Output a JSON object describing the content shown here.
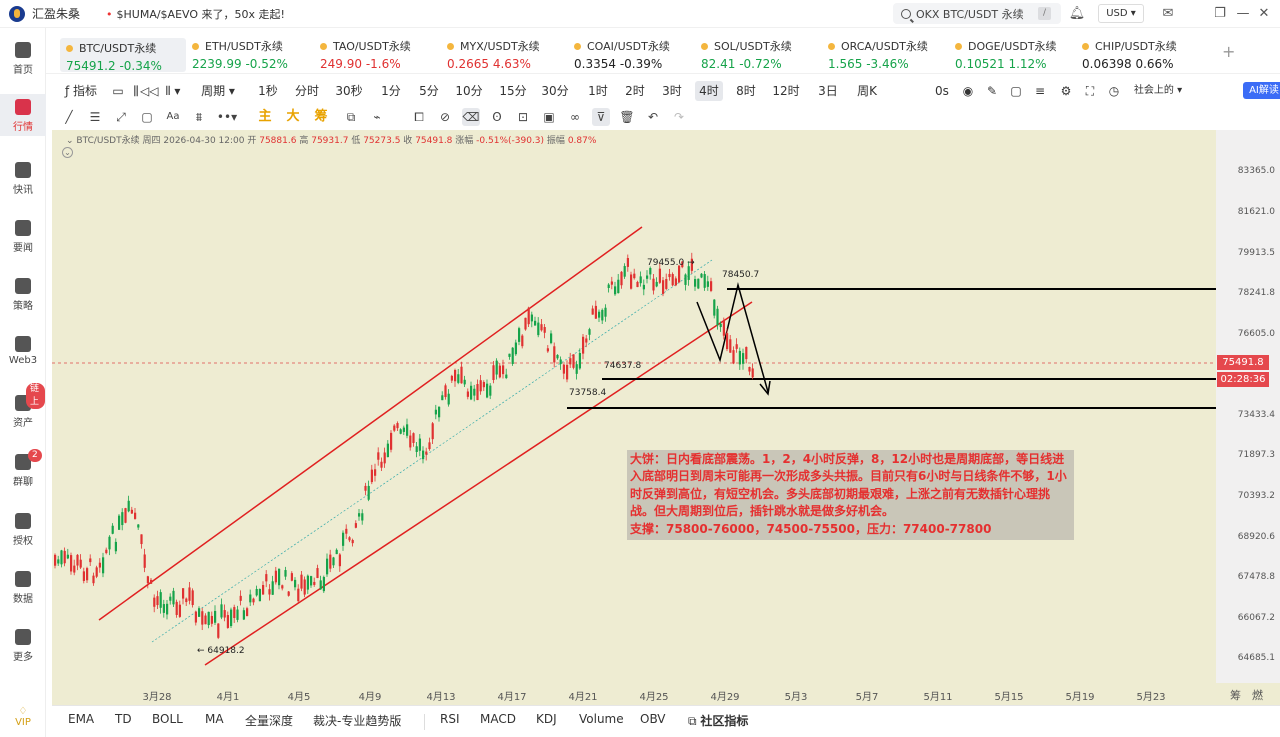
{
  "app": {
    "name": "汇盈朱桑",
    "ticker_message": "$HUMA/$AEVO 来了，50x 走起!",
    "search_placeholder": "OKX BTC/USDT 永续",
    "search_shortcut": "/",
    "currency": "USD"
  },
  "sidebar": {
    "items": [
      {
        "label": "首页",
        "icon": "home-icon"
      },
      {
        "label": "行情",
        "icon": "market-chart-icon",
        "active": true
      },
      {
        "label": "快讯",
        "icon": "flash-news-icon"
      },
      {
        "label": "要闻",
        "icon": "news-icon"
      },
      {
        "label": "策略",
        "icon": "robot-icon"
      },
      {
        "label": "Web3",
        "icon": "web3-icon"
      },
      {
        "label": "资产",
        "icon": "wallet-icon",
        "badge": "链上"
      },
      {
        "label": "群聊",
        "icon": "chat-icon",
        "badge": "2"
      },
      {
        "label": "授权",
        "icon": "auth-icon"
      },
      {
        "label": "数据",
        "icon": "data-icon"
      },
      {
        "label": "更多",
        "icon": "more-grid-icon"
      }
    ],
    "vip": "VIP"
  },
  "tickers": [
    {
      "name": "BTC/USDT永续",
      "price": "75491.2",
      "change": "-0.34%",
      "dir": "up"
    },
    {
      "name": "ETH/USDT永续",
      "price": "2239.99",
      "change": "-0.52%",
      "dir": "up"
    },
    {
      "name": "TAO/USDT永续",
      "price": "249.90",
      "change": "-1.6%",
      "dir": "dn"
    },
    {
      "name": "MYX/USDT永续",
      "price": "0.2665",
      "change": "4.63%",
      "dir": "dn"
    },
    {
      "name": "COAI/USDT永续",
      "price": "0.3354",
      "change": "-0.39%",
      "dir": "flat"
    },
    {
      "name": "SOL/USDT永续",
      "price": "82.41",
      "change": "-0.72%",
      "dir": "up"
    },
    {
      "name": "ORCA/USDT永续",
      "price": "1.565",
      "change": "-3.46%",
      "dir": "up"
    },
    {
      "name": "DOGE/USDT永续",
      "price": "0.10521",
      "change": "1.12%",
      "dir": "up"
    },
    {
      "name": "CHIP/USDT永续",
      "price": "0.06398",
      "change": "0.66%",
      "dir": "flat"
    }
  ],
  "toolbar": {
    "indicator_label": "指标",
    "period_label": "周期",
    "timeframes": [
      "1秒",
      "分时",
      "30秒",
      "1分",
      "5分",
      "10分",
      "15分",
      "30分",
      "1时",
      "2时",
      "3时",
      "4时",
      "8时",
      "12时",
      "3日",
      "周K"
    ],
    "selected_timeframe": "4时",
    "countdown": "0s",
    "community_label": "社会上的",
    "ai_label": "AI解读",
    "mode_labels": [
      "主",
      "大",
      "筹"
    ]
  },
  "chart_info": {
    "symbol": "BTC/USDT永续",
    "datetime": "周四 2026-04-30 12:00",
    "open_label": "开",
    "open": "75881.6",
    "high_label": "高",
    "high": "75931.7",
    "low_label": "低",
    "low": "75273.5",
    "close_label": "收",
    "close": "75491.8",
    "change_label": "涨幅",
    "change": "-0.51%(-390.3)",
    "amp_label": "振幅",
    "amp": "0.87%"
  },
  "chart_data": {
    "type": "candlestick",
    "y_ticks": [
      "83365.0",
      "81621.0",
      "79913.5",
      "78241.8",
      "76605.0",
      "75491.8",
      "73433.4",
      "71897.3",
      "70393.2",
      "68920.6",
      "67478.8",
      "66067.2",
      "64685.1"
    ],
    "x_ticks": [
      "3月28",
      "4月1",
      "4月5",
      "4月9",
      "4月13",
      "4月17",
      "4月21",
      "4月25",
      "4月29",
      "5月3",
      "5月7",
      "5月11",
      "5月15",
      "5月19",
      "5月23"
    ],
    "current_price": "75491.8",
    "countdown": "02:28:36",
    "annotations": [
      "79455.0",
      "78450.7",
      "74637.8",
      "73758.4",
      "64918.2"
    ]
  },
  "note": {
    "text": "大饼：日内看底部震荡。1，2，4小时反弹，8，12小时也是周期底部，等日线进入底部明日到周末可能再一次形成多头共振。目前只有6小时与日线条件不够，1小时反弹到高位，有短空机会。多头底部初期最艰难，上涨之前有无数插针心理挑战。但大周期到位后，插针跳水就是做多好机会。",
    "levels": "支撑：75800-76000，74500-75500，压力：77400-77800"
  },
  "bottom_indicators": [
    "EMA",
    "TD",
    "BOLL",
    "MA",
    "全量深度",
    "裁决-专业趋势版",
    "RSI",
    "MACD",
    "KDJ",
    "Volume",
    "OBV",
    "社区指标"
  ],
  "axis_corner": [
    "筹",
    "燃"
  ],
  "colors": {
    "accent": "#3b6cf6",
    "up": "#16a34a",
    "down": "#e03131",
    "chart_bg": "#eeecd2"
  }
}
